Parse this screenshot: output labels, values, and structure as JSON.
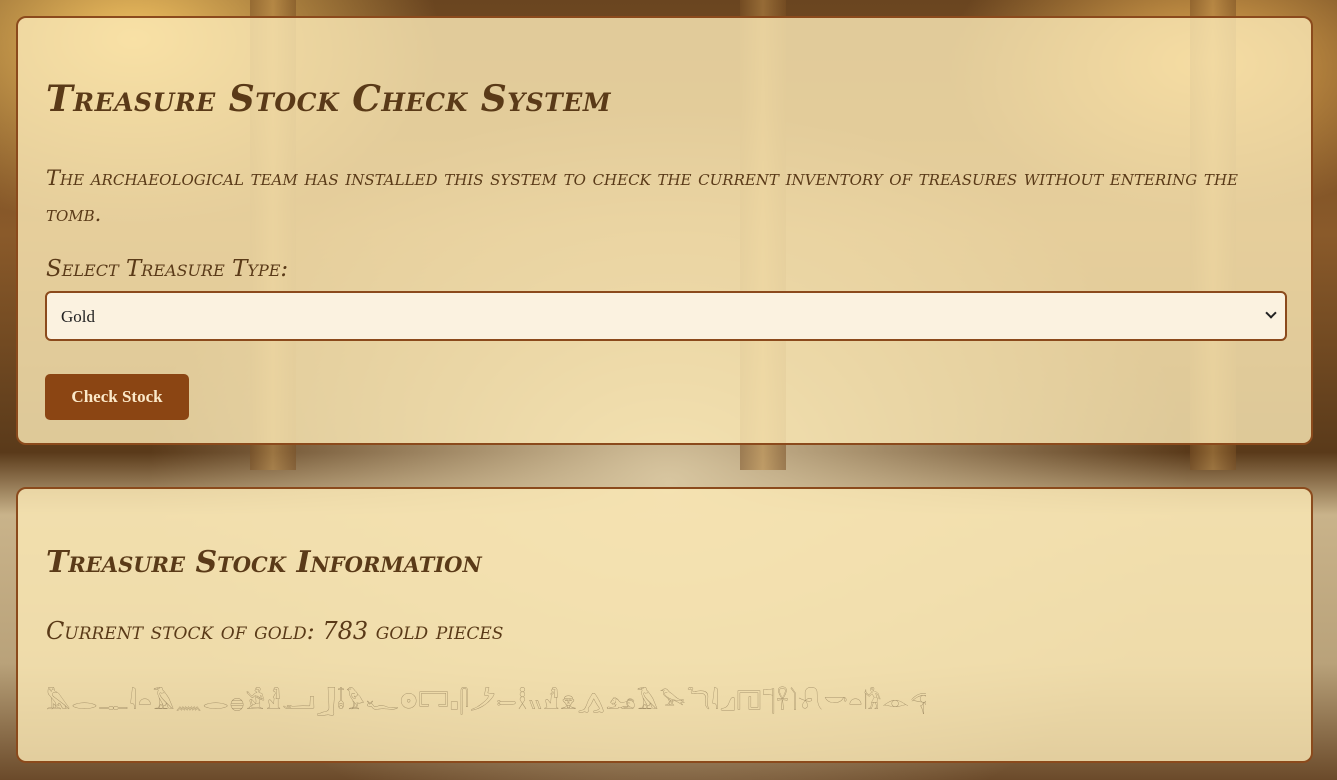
{
  "system": {
    "title": "Treasure Stock Check System",
    "description": "The archaeological team has installed this system to check the current inventory of treasures without entering the tomb.",
    "select_label": "Select Treasure Type:",
    "selected_option": "Gold",
    "check_button": "Check Stock"
  },
  "info": {
    "title": "Treasure Stock Information",
    "stock_text": "Current stock of gold: 783 gold pieces",
    "hieroglyphs": "𓅓𓂋𓊃𓇋𓏏𓄿𓈖𓂋𓐍𓀀𓁐𓂝𓃀𓄤𓅱𓆑𓇳𓉐𓊪𓋴𓌳𓍿𓎛𓏭𓀭𓁷𓂻𓃭𓄿𓅨𓆓𓇋𓈎𓉔𓊹𓋹𓌙𓍯𓎡𓏏𓀗𓁹𓂀𓃒𓄣𓅂𓆸"
  },
  "colors": {
    "panel_bg": "#fae8b4",
    "border": "#8b4a1c",
    "text": "#5a3a18",
    "button_bg": "#8b4513",
    "button_text": "#fbe8c8"
  }
}
